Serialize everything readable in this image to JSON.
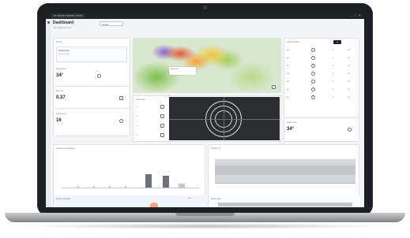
{
  "window": {
    "tab_title": "▪▪▪ ▪▪▪▪▪▪▪▪ ▪▪▪▪▪▪▪▪▪ ▪▪▪▪▪▪▪",
    "controls": [
      "–",
      "□",
      "✕"
    ]
  },
  "header": {
    "title": "Dashboard",
    "subtitle": "▪▪▪▪ ▪▪▪▪▪▪▪ ▪▪▪ ▪▪▪▪▪▪",
    "select_value": "▪▪▪▪▪▪▪▪"
  },
  "left_panel": {
    "heading": "▪▪▪▪▪▪▪",
    "alert_title": "▪▪▪▪▪▪▪ ▪▪▪▪▪",
    "alert_text": "▪▪▪▪▪ ▪▪▪▪ ▪▪▪▪▪",
    "metric_1": {
      "label": "▪▪▪▪ ▪▪▪▪▪▪▪",
      "value": "34°"
    },
    "metric_2": {
      "label": "▪▪▪▪ ▪▪▪▪",
      "value": "0.37"
    },
    "metric_3": {
      "label": "▪▪▪▪▪▪▪ ▪▪▪▪",
      "value": "16"
    }
  },
  "map_popup": {
    "text": "▪▪▪▪▪ ▪▪▪▪"
  },
  "radar_panel": {
    "heading": "▪▪▪▪▪ ▪▪▪▪▪",
    "rows": [
      "▪▪▪",
      "▪▪▪",
      "▪▪▪",
      "▪▪▪"
    ]
  },
  "right_panel": {
    "heading": "▪▪▪▪▪▪ ▪▪▪▪▪▪▪▪",
    "toggle": "▪▪",
    "rows": [
      {
        "label": "▪▪▪",
        "value": "▪▪°"
      },
      {
        "label": "▪▪▪",
        "value": "▪▪°"
      },
      {
        "label": "▪▪▪",
        "value": "▪▪°"
      },
      {
        "label": "▪▪▪",
        "value": "▪▪°"
      },
      {
        "label": "▪▪▪",
        "value": "▪▪°"
      },
      {
        "label": "▪▪▪",
        "value": "▪▪°"
      },
      {
        "label": "▪▪▪",
        "value": "▪▪°"
      }
    ],
    "summary_label": "▪▪▪▪▪▪▪ ▪▪▪▪",
    "summary_value": "34°"
  },
  "bottom_left": {
    "heading": "▪▪▪▪▪▪▪▪▪ ▪▪▪▪▪▪▪▪▪▪▪▪",
    "sub_heading": "▪▪▪▪▪▪▪ ▪▪▪▪▪▪▪▪▪",
    "link": "▪▪▪▪"
  },
  "bottom_right": {
    "heading": "▪▪▪▪▪▪▪▪ ▪▪",
    "sub_heading": "▪▪▪▪▪▪▪ ▪▪▪▪"
  },
  "colors": {
    "accent": "#3c64c8",
    "highlight": "#f0a878",
    "radar_bg": "#2b2d30"
  }
}
